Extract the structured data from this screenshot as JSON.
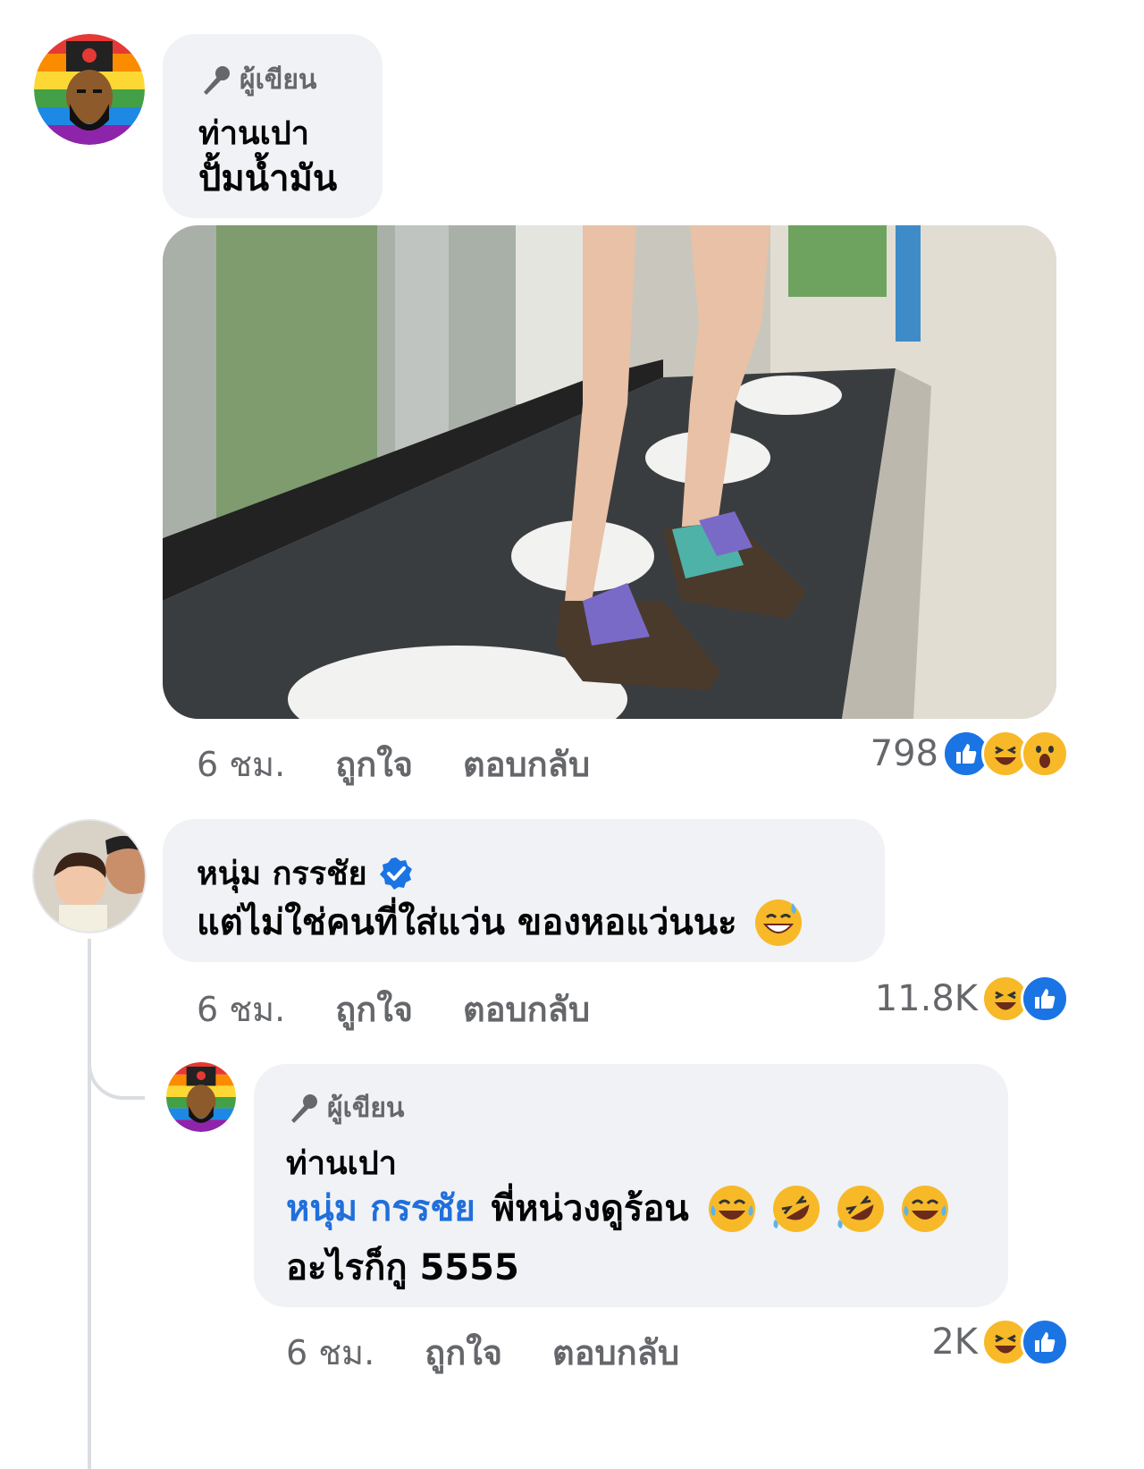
{
  "comments": [
    {
      "badge": "ผู้เขียน",
      "author": "ท่านเปา",
      "text": "ปั้มน้ำมัน",
      "time": "6 ชม.",
      "like_label": "ถูกใจ",
      "reply_label": "ตอบกลับ",
      "reaction_count": "798",
      "reactions": [
        "like-icon",
        "haha-icon",
        "wow-icon"
      ]
    },
    {
      "author": "หนุ่ม กรรชัย",
      "verified": true,
      "text": "แต่ไม่ใช่คนที่ใส่แว่น ของหอแว่นนะ",
      "emoji": [
        "sweat-smile-emoji"
      ],
      "time": "6 ชม.",
      "like_label": "ถูกใจ",
      "reply_label": "ตอบกลับ",
      "reaction_count": "11.8K",
      "reactions": [
        "haha-icon",
        "like-icon"
      ]
    },
    {
      "badge": "ผู้เขียน",
      "author": "ท่านเปา",
      "mention": "หนุ่ม กรรชัย",
      "text_line1": "พี่หน่วงดูร้อน",
      "text_line2": "อะไรก็กู 5555",
      "emoji": [
        "joy-emoji",
        "rofl-emoji",
        "rofl-emoji",
        "joy-emoji"
      ],
      "time": "6 ชม.",
      "like_label": "ถูกใจ",
      "reply_label": "ตอบกลับ",
      "reaction_count": "2K",
      "reactions": [
        "haha-icon",
        "like-icon"
      ]
    }
  ],
  "colors": {
    "bubble": "#f0f2f5",
    "meta_text": "#65676b",
    "mention": "#216fdb",
    "like": "#1b74e4",
    "haha": "#f7b928"
  }
}
